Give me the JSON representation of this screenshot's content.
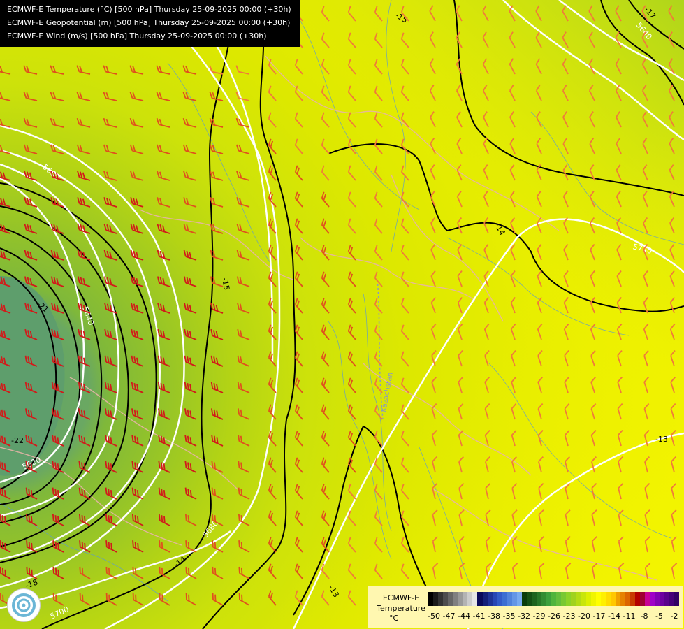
{
  "header": {
    "line1": "ECMWF-E Temperature (°C) [500 hPa] Thursday 25-09-2025 00:00 (+30h)",
    "line2": "ECMWF-E Geopotential (m) [500 hPa] Thursday 25-09-2025 00:00 (+30h)",
    "line3": "ECMWF-E Wind (m/s) [500 hPa] Thursday 25-09-2025 00:00 (+30h)"
  },
  "contour_labels": {
    "t15_top": "-15",
    "t17_top": "-17",
    "z5640_tr": "5640",
    "z5660_w": "5660",
    "z5640_w": "5640",
    "t21_w": "-21",
    "t22_w": "-22",
    "z5620_sw": "5620",
    "t15_mid": "-15",
    "t14_ne": "-14",
    "z5740_e": "5740",
    "t13_se": "-13",
    "t14_sw": "-14",
    "z5680_sw": "5680",
    "t18_sw": "-18",
    "z5700_sw": "5700",
    "t13_s": "-13"
  },
  "map_label": "Kazachstan",
  "legend": {
    "title_line1": "ECMWF-E",
    "title_line2": "Temperature",
    "unit": "°C",
    "ticks": [
      "-50",
      "-47",
      "-44",
      "-41",
      "-38",
      "-35",
      "-32",
      "-29",
      "-26",
      "-23",
      "-20",
      "-17",
      "-14",
      "-11",
      "-8",
      "-5",
      "-2"
    ],
    "colors": [
      "#000000",
      "#1a1a1a",
      "#333333",
      "#4d4d4d",
      "#666666",
      "#808080",
      "#999999",
      "#b3b3b3",
      "#cccccc",
      "#e6e6e6",
      "#0a0a5a",
      "#141f78",
      "#1e3296",
      "#2846b4",
      "#325ac8",
      "#3c6ed2",
      "#5082dc",
      "#6496e6",
      "#78aaf0",
      "#0a3c0a",
      "#145014",
      "#1e641e",
      "#287828",
      "#328c32",
      "#3ca03c",
      "#50b43c",
      "#64be3c",
      "#78c832",
      "#8cd228",
      "#a0d21e",
      "#b4dc14",
      "#c8e60a",
      "#dcf000",
      "#f0f500",
      "#ffff00",
      "#fff000",
      "#ffdc00",
      "#ffc800",
      "#f0a000",
      "#e68200",
      "#dc6400",
      "#c83c00",
      "#b40000",
      "#a00032",
      "#c80096",
      "#a000c8",
      "#8200b4",
      "#6e00a0",
      "#5a008c",
      "#460078",
      "#320064"
    ]
  }
}
